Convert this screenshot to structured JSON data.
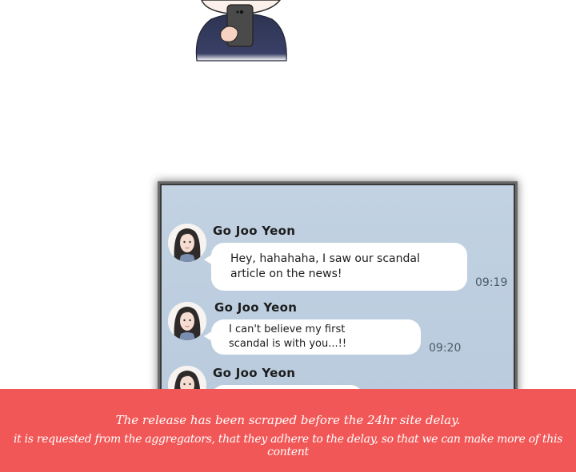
{
  "chat": {
    "messages": [
      {
        "sender": "Go Joo Yeon",
        "lines": [
          "Hey, hahahaha, I saw our scandal",
          "article on the news!"
        ],
        "time": "09:19"
      },
      {
        "sender": "Go Joo Yeon",
        "lines": [
          "I can't believe my first",
          "scandal is with you...!!"
        ],
        "time": "09:20"
      },
      {
        "sender": "Go Joo Yeon",
        "lines": [],
        "time": ""
      }
    ],
    "bg_color": "#c0d0e1"
  },
  "notice": {
    "line1": "The release has been scraped before the 24hr site delay.",
    "line2": "it is requested from the aggregators, that they adhere to the delay, so that we can make more of this content",
    "bg_color": "#f25757"
  },
  "icons": [
    "character-illustration",
    "avatar-icon"
  ]
}
